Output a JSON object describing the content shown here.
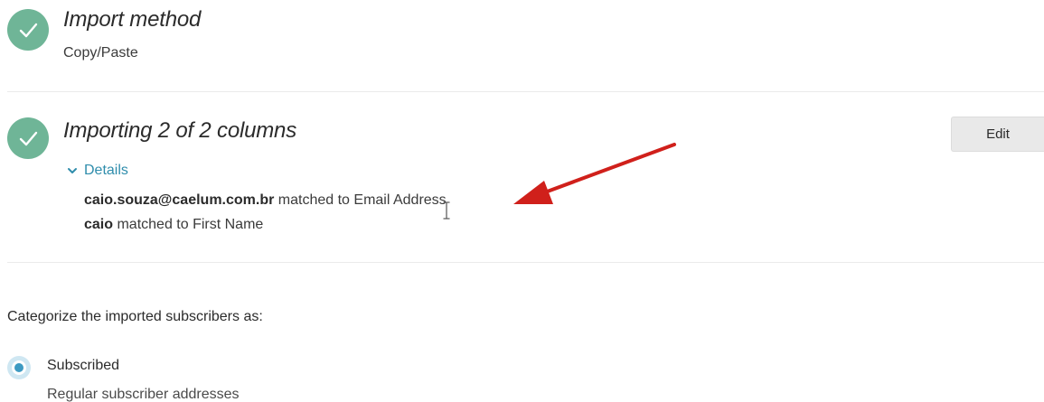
{
  "steps": [
    {
      "title": "Import method",
      "subtitle": "Copy/Paste",
      "status_icon": "check-icon"
    },
    {
      "title": "Importing 2 of 2 columns",
      "edit_label": "Edit",
      "details_label": "Details",
      "status_icon": "check-icon",
      "matches": [
        {
          "field": "caio.souza@caelum.com.br",
          "text": "matched to Email Address"
        },
        {
          "field": "caio",
          "text": "matched to First Name"
        }
      ]
    }
  ],
  "categorize": {
    "label": "Categorize the imported subscribers as:",
    "options": [
      {
        "label": "Subscribed",
        "description": "Regular subscriber addresses",
        "selected": true
      }
    ]
  },
  "colors": {
    "check": "#6fb597",
    "link": "#2f8dac",
    "radio": "#3d9ac2",
    "annotation_arrow": "#d0201b"
  }
}
